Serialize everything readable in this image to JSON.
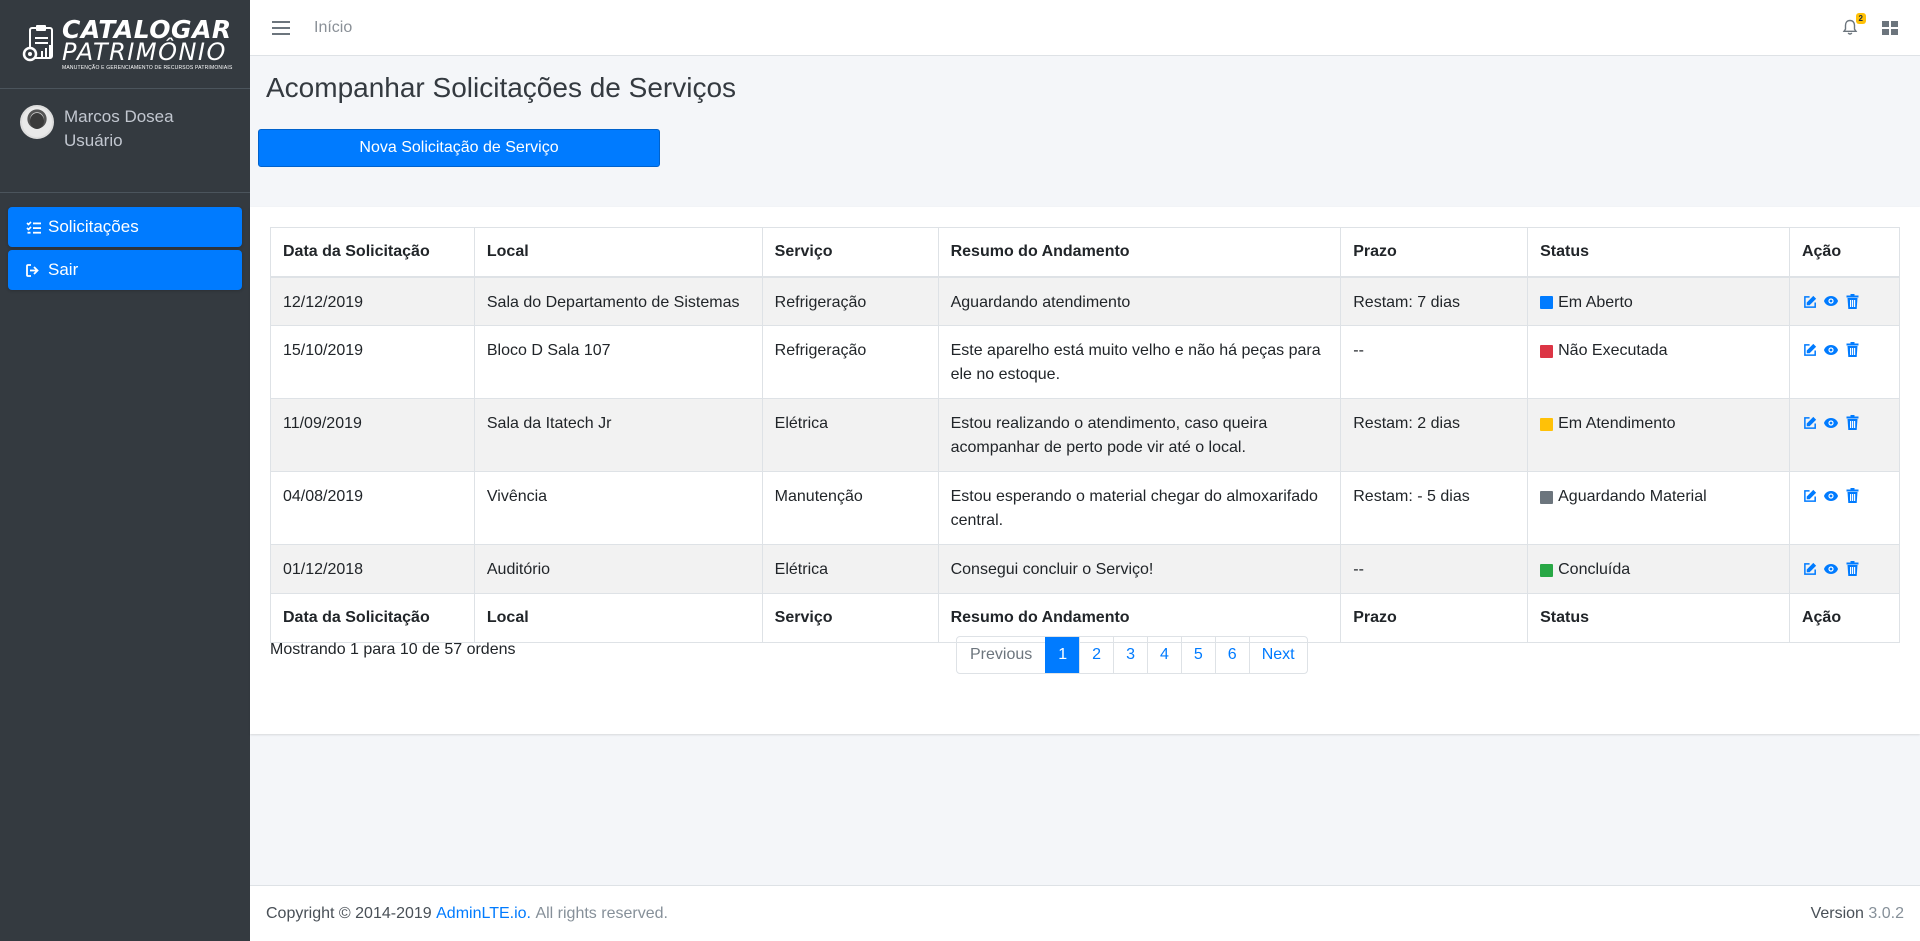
{
  "brand": {
    "line1": "CATALOGAR",
    "line2": "PATRIMÔNIO",
    "line3": "MANUTENÇÃO E GERENCIAMENTO DE RECURSOS PATRIMONIAIS"
  },
  "user": {
    "name": "Marcos Dosea",
    "role": "Usuário"
  },
  "sidebar": {
    "items": [
      {
        "label": "Solicitações",
        "icon": "tasks-icon"
      },
      {
        "label": "Sair",
        "icon": "sign-out-icon"
      }
    ]
  },
  "topbar": {
    "home_link": "Início",
    "notifications_count": "2"
  },
  "page": {
    "title": "Acompanhar Solicitações de Serviços",
    "new_button": "Nova Solicitação de Serviço"
  },
  "table": {
    "headers": [
      "Data da Solicitação",
      "Local",
      "Serviço",
      "Resumo do Andamento",
      "Prazo",
      "Status",
      "Ação"
    ],
    "rows": [
      {
        "date": "12/12/2019",
        "local": "Sala do Departamento de Sistemas",
        "service": "Refrigeração",
        "summary": "Aguardando atendimento",
        "deadline": "Restam: 7 dias",
        "status": "Em Aberto",
        "status_color": "#007bff"
      },
      {
        "date": "15/10/2019",
        "local": "Bloco D Sala 107",
        "service": "Refrigeração",
        "summary": "Este aparelho está muito velho e não há peças para ele no estoque.",
        "deadline": "--",
        "status": "Não Executada",
        "status_color": "#dc3545"
      },
      {
        "date": "11/09/2019",
        "local": "Sala da Itatech Jr",
        "service": "Elétrica",
        "summary": "Estou realizando o atendimento, caso queira acompanhar de perto pode vir até o local.",
        "deadline": "Restam: 2 dias",
        "status": "Em Atendimento",
        "status_color": "#ffc107"
      },
      {
        "date": "04/08/2019",
        "local": "Vivência",
        "service": "Manutenção",
        "summary": "Estou esperando o material chegar do almoxarifado central.",
        "deadline": "Restam: - 5 dias",
        "status": "Aguardando Material",
        "status_color": "#6c757d"
      },
      {
        "date": "01/12/2018",
        "local": "Auditório",
        "service": "Elétrica",
        "summary": "Consegui concluir o Serviço!",
        "deadline": "--",
        "status": "Concluída",
        "status_color": "#28a745"
      }
    ]
  },
  "pagination": {
    "info": "Mostrando 1 para 10 de 57 ordens",
    "previous": "Previous",
    "pages": [
      "1",
      "2",
      "3",
      "4",
      "5",
      "6"
    ],
    "next": "Next"
  },
  "footer": {
    "copyright": "Copyright © 2014-2019",
    "link": "AdminLTE.io.",
    "rights": "All rights reserved.",
    "version_label": "Version",
    "version": "3.0.2"
  }
}
